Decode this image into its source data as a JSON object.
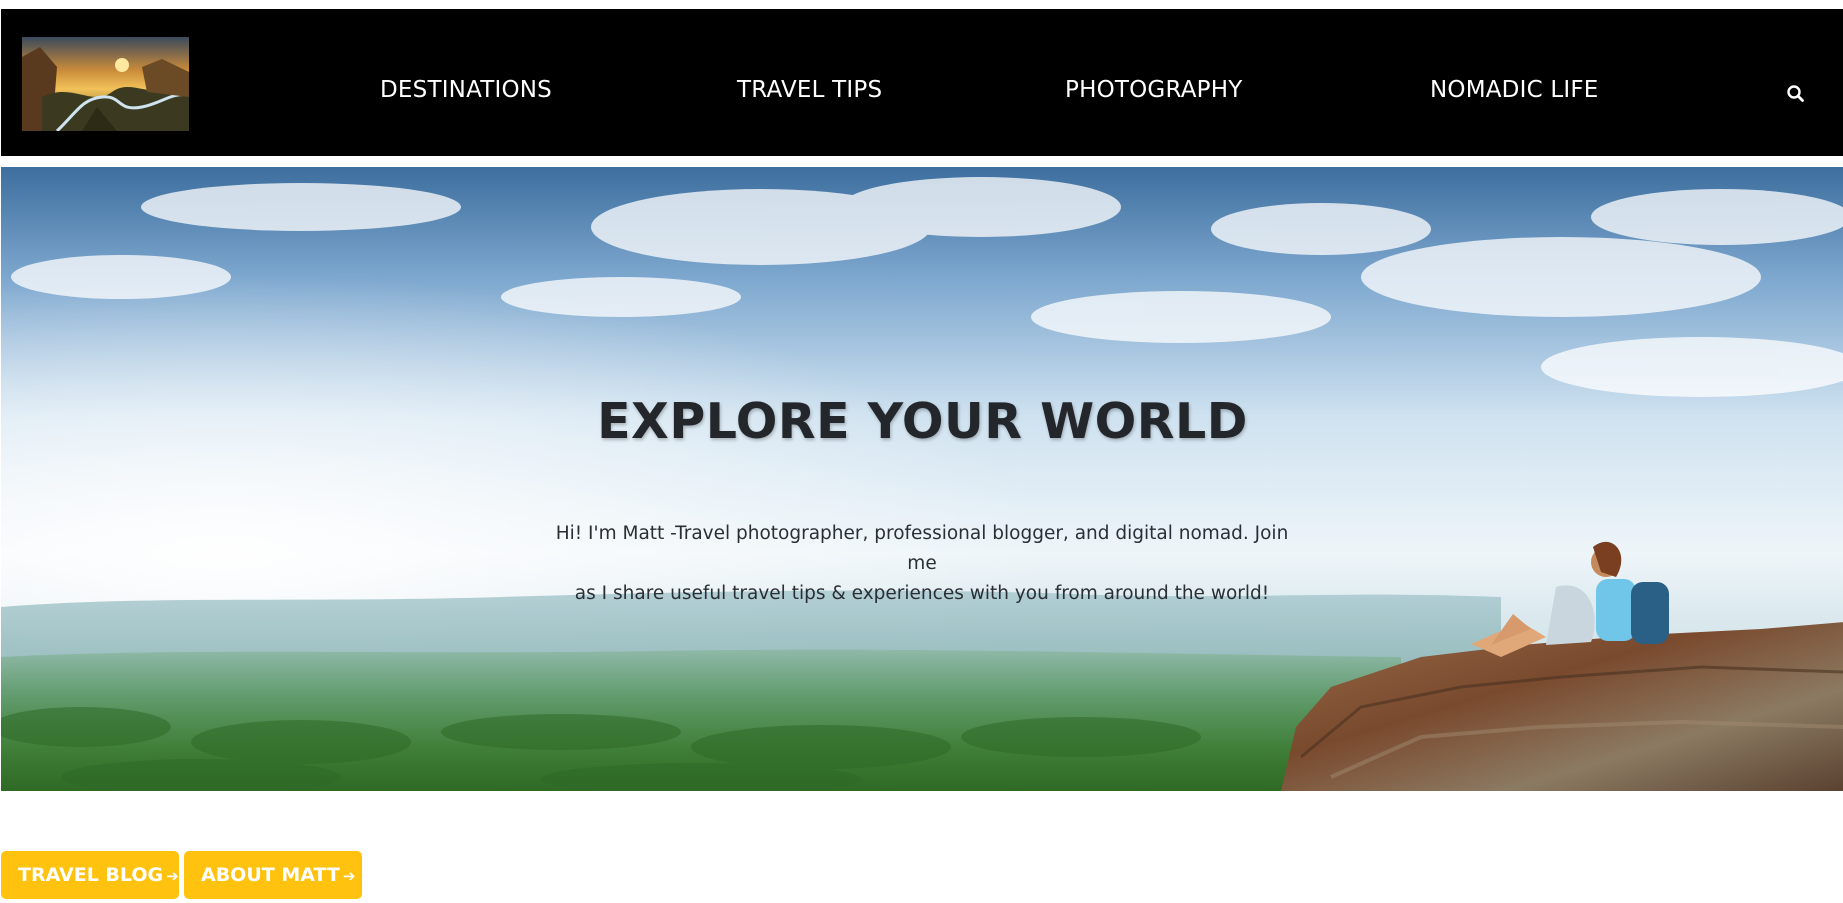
{
  "nav": {
    "logo_alt": "Mountain river landscape logo",
    "links": [
      {
        "label": "DESTINATIONS"
      },
      {
        "label": "TRAVEL TIPS"
      },
      {
        "label": "PHOTOGRAPHY"
      },
      {
        "label": "NOMADIC LIFE"
      }
    ],
    "search_icon": "search-icon"
  },
  "hero": {
    "title": "EXPLORE YOUR WORLD",
    "intro_line1": "Hi! I'm Matt -Travel photographer, professional blogger, and digital nomad. Join me",
    "intro_line2": "as I share useful travel tips & experiences with you from around the world!"
  },
  "buttons": {
    "travel_blog": "TRAVEL BLOG",
    "about": "ABOUT MATT",
    "arrow": "➔"
  },
  "colors": {
    "navbar_bg": "#000000",
    "accent_button": "#ffc20e",
    "title_text": "#23272b"
  }
}
